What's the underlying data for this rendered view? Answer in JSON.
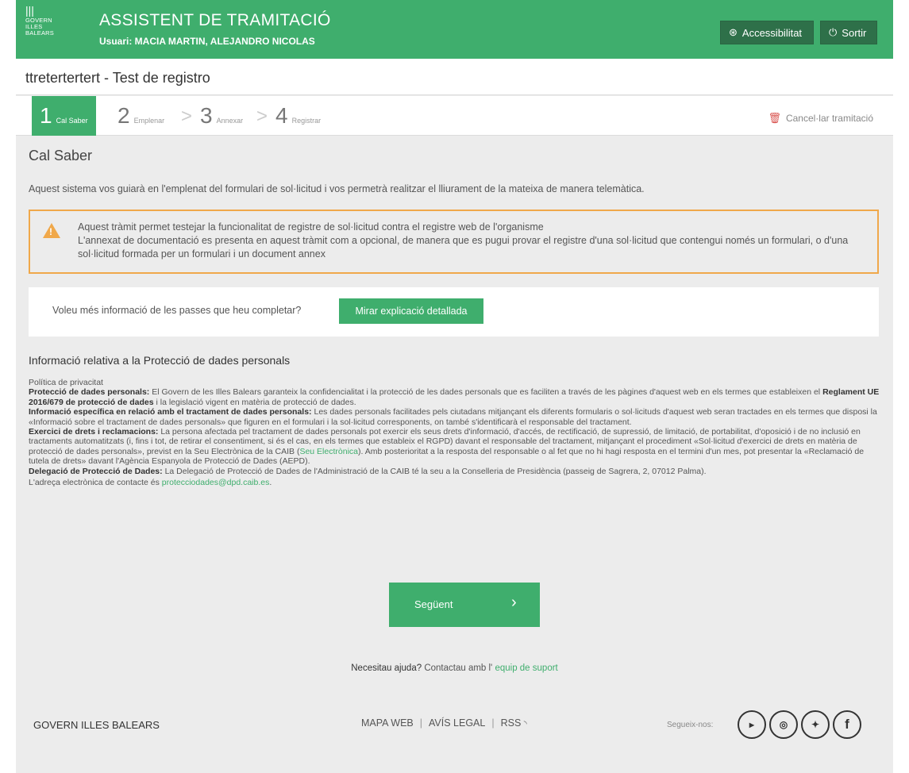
{
  "header": {
    "logo_mark": "|||",
    "logo_lines": [
      "GOVERN",
      "ILLES",
      "BALEARS"
    ],
    "title": "ASSISTENT DE TRAMITACIÓ",
    "user": "Usuari: MACIA MARTIN, ALEJANDRO NICOLAS",
    "accessibility_label": "Accessibilitat",
    "logout_label": "Sortir"
  },
  "procedure_title": "ttretertertert - Test de registro",
  "steps": [
    {
      "num": "1",
      "label": "Cal Saber"
    },
    {
      "num": "2",
      "label": "Emplenar"
    },
    {
      "num": "3",
      "label": "Annexar"
    },
    {
      "num": "4",
      "label": "Registrar"
    }
  ],
  "cancel_label": "Cancel·lar tramitació",
  "content": {
    "title": "Cal Saber",
    "intro": "Aquest sistema vos guiarà en l'emplenat del formulari de sol·licitud i vos permetrà realitzar el lliurament de la mateixa de manera telemàtica.",
    "warning_line1": "Aquest tràmit permet testejar la funcionalitat de registre de sol·licitud contra el registre web de l'organisme",
    "warning_line2": "L'annexat de documentació es presenta en aquest tràmit com a opcional, de manera que es pugui provar el registre d'una sol·licitud que contengui només un formulari, o d'una sol·licitud formada per un formulari i un document annex",
    "info_question": "Voleu més informació de les passes que heu completar?",
    "info_button": "Mirar explicació detallada"
  },
  "privacy": {
    "title": "Informació relativa a la Protecció de dades personals",
    "policy": "Política de privacitat",
    "p1_label": "Protecció de dades personals:",
    "p1_text": " El Govern de les Illes Balears garanteix la confidencialitat i la protecció de les dades personals que es faciliten a través de les pàgines d'aquest web en els termes que estableixen el ",
    "p1_bold": "Reglament UE 2016/679 de protecció de dades",
    "p1_text2": " i la legislació vigent en matèria de protecció de dades.",
    "p2_label": "Informació específica en relació amb el tractament de dades personals:",
    "p2_text": " Les dades personals facilitades pels ciutadans mitjançant els diferents formularis o sol·licituds d'aquest web seran tractades en els termes que disposi la «Informació sobre el tractament de dades personals» que figuren en el formulari i la sol·licitud corresponents, on també s'identificarà el responsable del tractament.",
    "p3_label": "Exercici de drets i reclamacions:",
    "p3_text": " La persona afectada pel tractament de dades personals pot exercir els seus drets d'informació, d'accés, de rectificació, de supressió, de limitació, de portabilitat, d'oposició i de no inclusió en tractaments automatitzats (i, fins i tot, de retirar el consentiment, si és el cas, en els termes que estableix el RGPD) davant el responsable del tractament, mitjançant el procediment «Sol·licitud d'exercici de drets en matèria de protecció de dades personals», previst en la Seu Electrònica de la CAIB (",
    "p3_link": "Seu Electrònica",
    "p3_text2": "). Amb posterioritat a la resposta del responsable o al fet que no hi hagi resposta en el termini d'un mes, pot presentar la «Reclamació de tutela de drets» davant l'Agència Espanyola de Protecció de Dades (AEPD).",
    "p4_label": "Delegació de Protecció de Dades:",
    "p4_text": " La Delegació de Protecció de Dades de l'Administració de la CAIB té la seu a la Conselleria de Presidència (passeig de Sagrera, 2, 07012 Palma).",
    "p5_text": "L'adreça electrònica de contacte és ",
    "p5_link": "protecciodades@dpd.caib.es",
    "p5_end": "."
  },
  "next_button": "Següent",
  "help": {
    "bold": "Necesitau ajuda?",
    "text": " Contactau amb l' ",
    "link": "equip de suport"
  },
  "footer": {
    "org": "GOVERN ILLES BALEARS",
    "map": "MAPA WEB",
    "legal": "AVÍS LEGAL",
    "rss": "RSS",
    "follow": "Segueix-nos:",
    "socials": [
      "You Tube",
      "Instagram",
      "Twitter",
      "Facebook"
    ]
  }
}
